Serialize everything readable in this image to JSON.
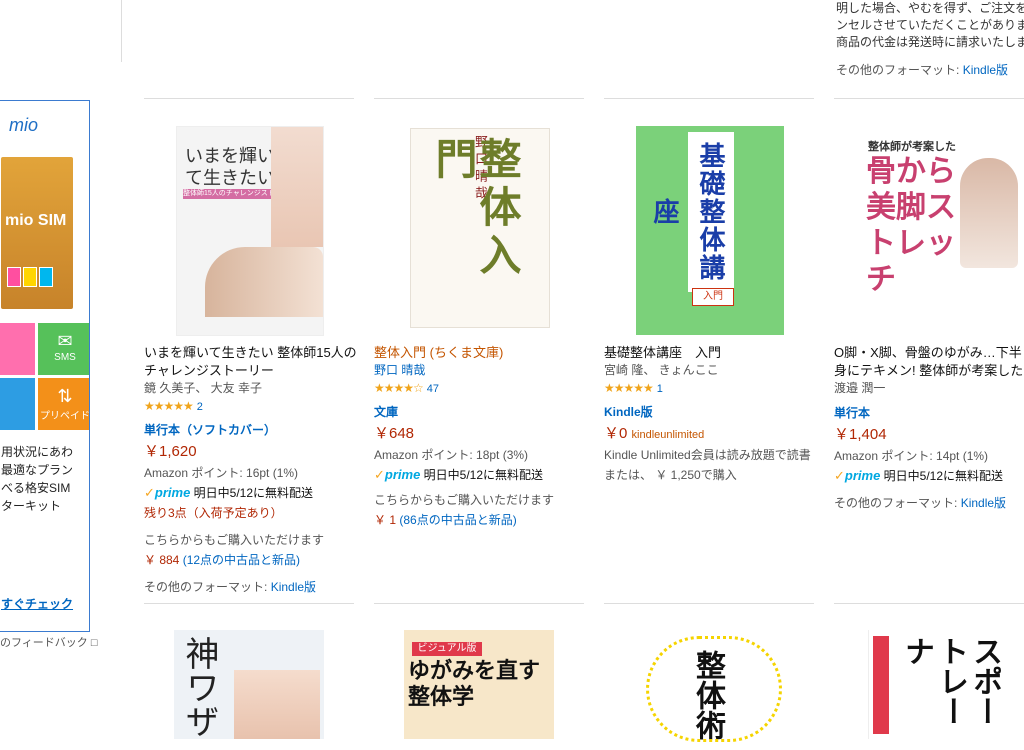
{
  "topright": {
    "lines": [
      "明した場合、やむを得ず、ご注文をキ",
      "ンセルさせていただくことがあります",
      "商品の代金は発送時に請求いたします"
    ],
    "other_formats_label": "その他のフォーマット:",
    "other_formats_link": "Kindle版"
  },
  "ad": {
    "brand": "mio",
    "sim_text": "mio SIM",
    "tile_sms": "SMS",
    "tile_prepaid": "プリペイド",
    "desc": [
      "用状況にあわ",
      "最適なプラン",
      "べる格安SIM",
      "ターキット"
    ],
    "cta": "すぐチェック",
    "feedback": "のフィードバック"
  },
  "products": [
    {
      "cover_title": "いまを輝いて生きたい",
      "cover_subtitle": "整体師15人のチャレンジストーリー",
      "title": "いまを輝いて生きたい 整体師15人のチャレンジストーリー",
      "authors": "鏡 久美子、 大友 幸子",
      "rating": "★★★★★",
      "reviews": "2",
      "format": "単行本（ソフトカバー）",
      "price": "￥1,620",
      "points": "Amazon ポイント: 16pt (1%)",
      "prime": "prime",
      "delivery": "明日中5/12に無料配送",
      "stock": "残り3点（入荷予定あり）",
      "other_buy": "こちらからもご購入いただけます",
      "used_price": "￥ 884",
      "used_text": "(12点の中古品と新品)",
      "other_formats_label": "その他のフォーマット:",
      "other_formats_link": "Kindle版"
    },
    {
      "cover_title": "整体入門",
      "cover_author": "野口晴哉",
      "title": "整体入門 (ちくま文庫)",
      "authors": "野口 晴哉",
      "rating": "★★★★☆",
      "reviews": "47",
      "format": "文庫",
      "price": "￥648",
      "points": "Amazon ポイント: 18pt (3%)",
      "prime": "prime",
      "delivery": "明日中5/12に無料配送",
      "other_buy": "こちらからもご購入いただけます",
      "used_price": "￥ 1",
      "used_text": "(86点の中古品と新品)"
    },
    {
      "cover_title": "基礎整体講座",
      "cover_tag": "入門",
      "title": "基礎整体講座　入門",
      "authors": "宮崎 隆、 きょんここ",
      "rating": "★★★★★",
      "reviews": "1",
      "format": "Kindle版",
      "price": "￥0",
      "ku": "kindleunlimited",
      "ku_text": "Kindle Unlimited会員は読み放題で読書",
      "alt_price": "または、 ￥ 1,250で購入"
    },
    {
      "cover_title": "骨から美脚ストレッチ",
      "cover_header": "整体師が考案した",
      "title": "O脚・X脚、骨盤のゆがみ…下半身にテキメン! 整体師が考案した 骨から美脚ストレッチ",
      "authors": "渡邉 潤一",
      "format": "単行本",
      "price": "￥1,404",
      "points": "Amazon ポイント: 14pt (1%)",
      "prime": "prime",
      "delivery": "明日中5/12に無料配送",
      "other_formats_label": "その他のフォーマット:",
      "other_formats_link": "Kindle版"
    }
  ],
  "row2": [
    {
      "cover_title": "神ワザ"
    },
    {
      "cover_title": "ゆがみを直す整体学",
      "cover_tag": "ビジュアル版"
    },
    {
      "cover_title": "整体術"
    },
    {
      "cover_title": "スポートレーナ"
    }
  ]
}
